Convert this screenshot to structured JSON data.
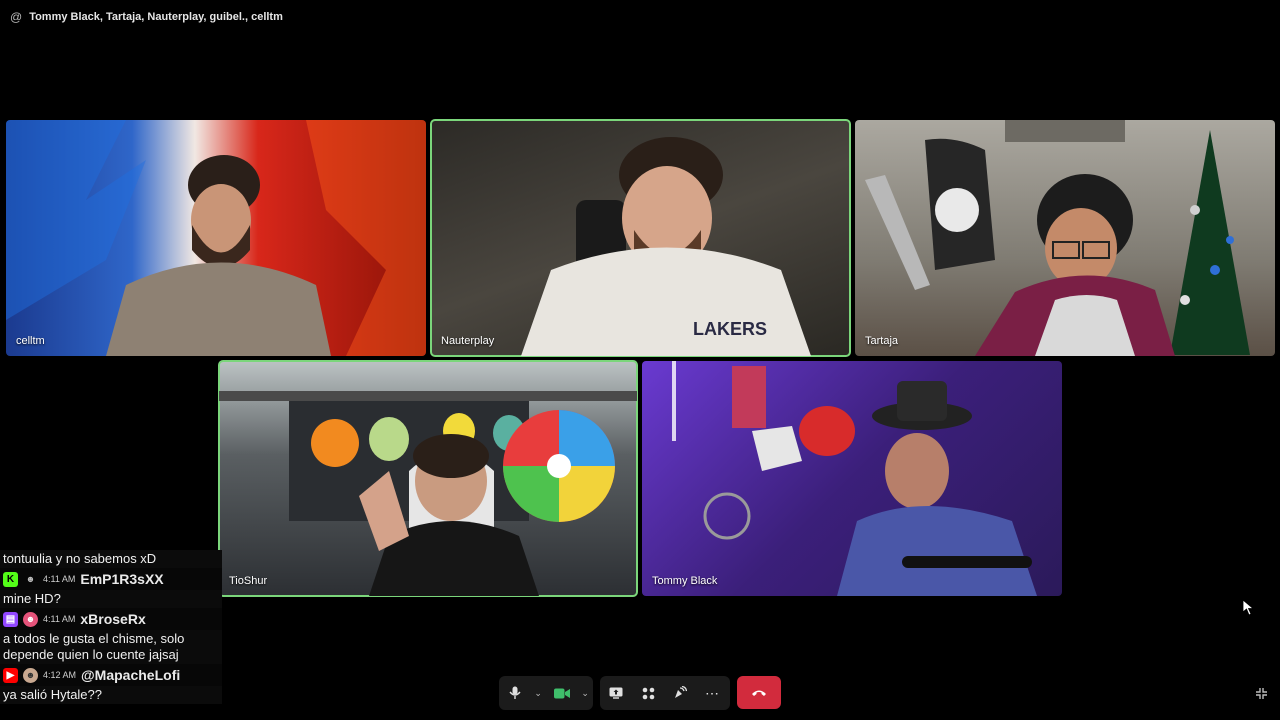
{
  "header": {
    "at_icon": "@",
    "participants_title": "Tommy Black, Tartaja, Nauterplay, guibel., celltm"
  },
  "tiles": [
    {
      "name": "celltm"
    },
    {
      "name": "Nauterplay"
    },
    {
      "name": "Tartaja"
    },
    {
      "name": "TioShur"
    },
    {
      "name": "Tommy Black"
    }
  ],
  "chat": {
    "partial_message": "tontuulia y no sabemos xD",
    "messages": [
      {
        "platform": "kick",
        "time": "4:11 AM",
        "user": "EmP1R3sXX",
        "text": "mine HD?"
      },
      {
        "platform": "twitch",
        "time": "4:11 AM",
        "user": "xBroseRx",
        "text": "a todos le gusta el chisme, solo depende quien lo cuente jajsaj"
      },
      {
        "platform": "youtube",
        "time": "4:12 AM",
        "user": "@MapacheLofi",
        "text": "ya salió Hytale??"
      }
    ]
  },
  "colors": {
    "speaking_outline": "#7bd67b",
    "end_call": "#d22b3d",
    "camera_active": "#3fbf6b",
    "twitch": "#9146ff",
    "youtube": "#ff0000",
    "kick": "#53fc18"
  },
  "controls": {
    "icons": [
      "microphone-icon",
      "chevron-down-icon",
      "camera-icon",
      "chevron-down-icon",
      "screen-share-icon",
      "activities-icon",
      "soundboard-icon",
      "more-icon",
      "end-call-icon",
      "minimize-icon"
    ]
  }
}
